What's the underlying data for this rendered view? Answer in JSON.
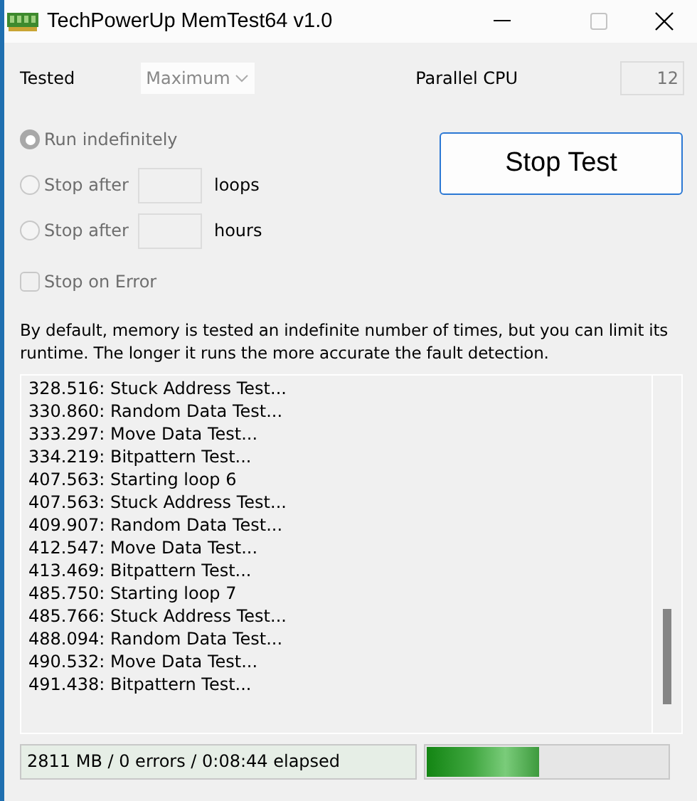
{
  "window": {
    "title": "TechPowerUp MemTest64 v1.0"
  },
  "tested": {
    "label": "Tested",
    "value": "Maximum"
  },
  "parallel_cpu": {
    "label": "Parallel CPU",
    "value": "12"
  },
  "options": [
    {
      "kind": "radio",
      "label": "Run indefinitely",
      "selected": true
    },
    {
      "kind": "radio_field",
      "label": "Stop after",
      "unit": "loops",
      "selected": false
    },
    {
      "kind": "radio_field",
      "label": "Stop after",
      "unit": "hours",
      "selected": false
    },
    {
      "kind": "checkbox",
      "label": "Stop on Error",
      "checked": false
    }
  ],
  "action_button": "Stop Test",
  "description": "By default, memory is tested an indefinite number of times, but you can limit its runtime. The longer it runs the more accurate the fault detection.",
  "log": [
    "328.516: Stuck Address Test...",
    "330.860: Random Data Test...",
    "333.297: Move Data Test...",
    "334.219: Bitpattern Test...",
    "407.563: Starting loop 6",
    "407.563: Stuck Address Test...",
    "409.907: Random Data Test...",
    "412.547: Move Data Test...",
    "413.469: Bitpattern Test...",
    "485.750: Starting loop 7",
    "485.766: Stuck Address Test...",
    "488.094: Random Data Test...",
    "490.532: Move Data Test...",
    "491.438: Bitpattern Test..."
  ],
  "status": {
    "text": "2811 MB / 0 errors / 0:08:44 elapsed",
    "level": 0.47
  }
}
